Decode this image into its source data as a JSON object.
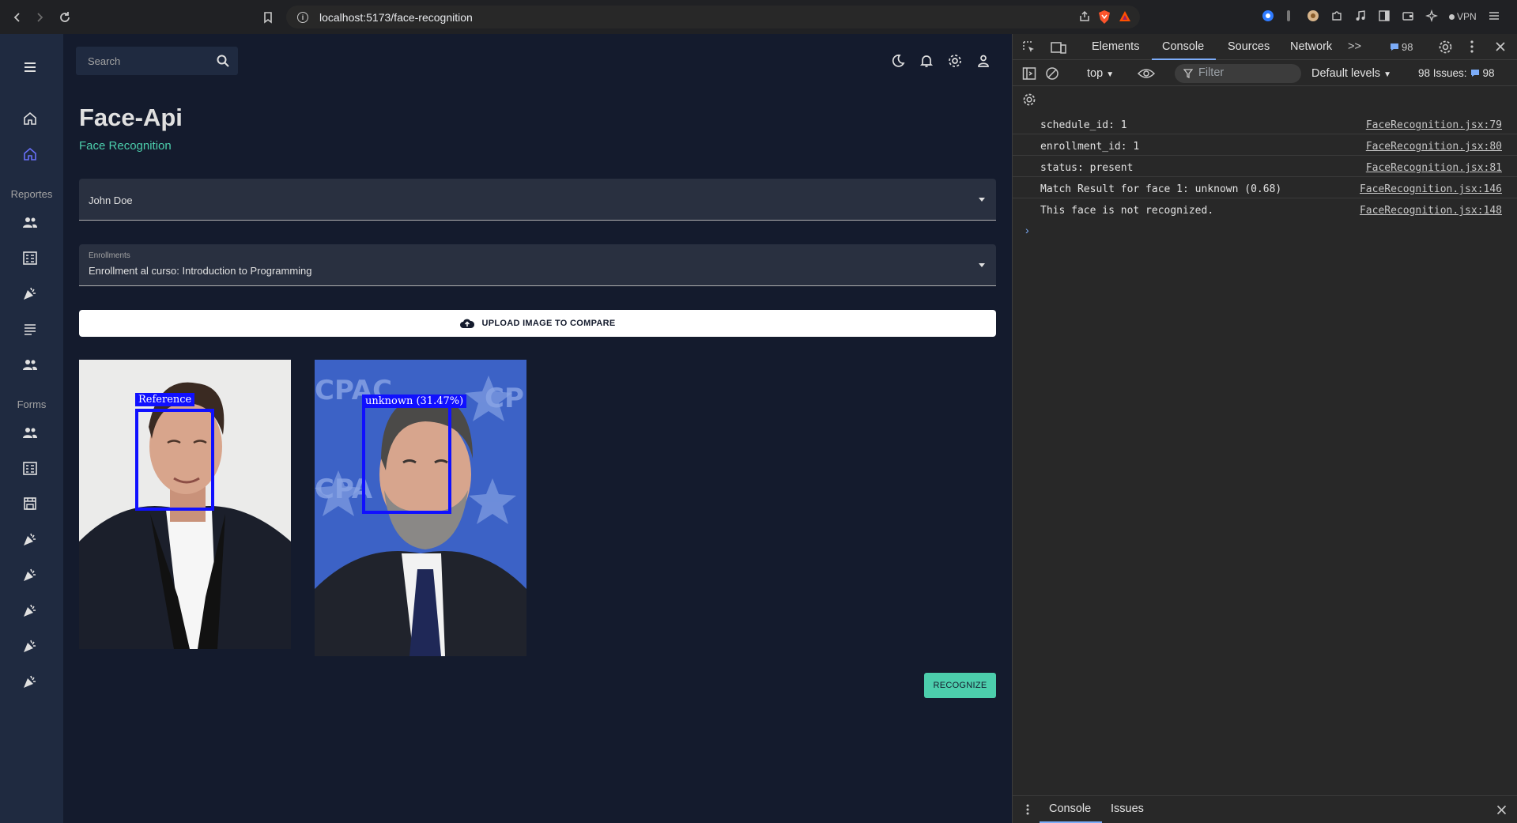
{
  "browser": {
    "url": "localhost:5173/face-recognition",
    "vpn_label": "VPN"
  },
  "sidebar": {
    "section_reports": "Reportes",
    "section_forms": "Forms"
  },
  "topbar": {
    "search_placeholder": "Search"
  },
  "page": {
    "title": "Face-Api",
    "subtitle": "Face Recognition",
    "student_select_value": "John Doe",
    "enrollment_label": "Enrollments",
    "enrollment_value": "Enrollment al curso: Introduction to Programming",
    "upload_label": "UPLOAD IMAGE TO COMPARE",
    "reference_tag": "Reference",
    "compare_tag": "unknown (31.47%)",
    "recognize_label": "RECOGNIZE"
  },
  "devtools": {
    "tabs": [
      "Elements",
      "Console",
      "Sources",
      "Network"
    ],
    "active_tab": "Console",
    "badge_count": "98",
    "context": "top",
    "filter_placeholder": "Filter",
    "levels": "Default levels",
    "issues_label": "98 Issues:",
    "issues_count": "98",
    "logs": [
      {
        "msg": "schedule_id: 1",
        "src": "FaceRecognition.jsx:79"
      },
      {
        "msg": "enrollment_id: 1",
        "src": "FaceRecognition.jsx:80"
      },
      {
        "msg": "status: present",
        "src": "FaceRecognition.jsx:81"
      },
      {
        "msg": "Match Result for face 1: unknown (0.68)",
        "src": "FaceRecognition.jsx:146"
      },
      {
        "msg": "This face is not recognized.",
        "src": "FaceRecognition.jsx:148"
      }
    ],
    "drawer_tabs": [
      "Console",
      "Issues"
    ]
  },
  "colors": {
    "accent_green": "#4cceac",
    "accent_blue": "#6870fa",
    "face_box": "#1010ff"
  }
}
